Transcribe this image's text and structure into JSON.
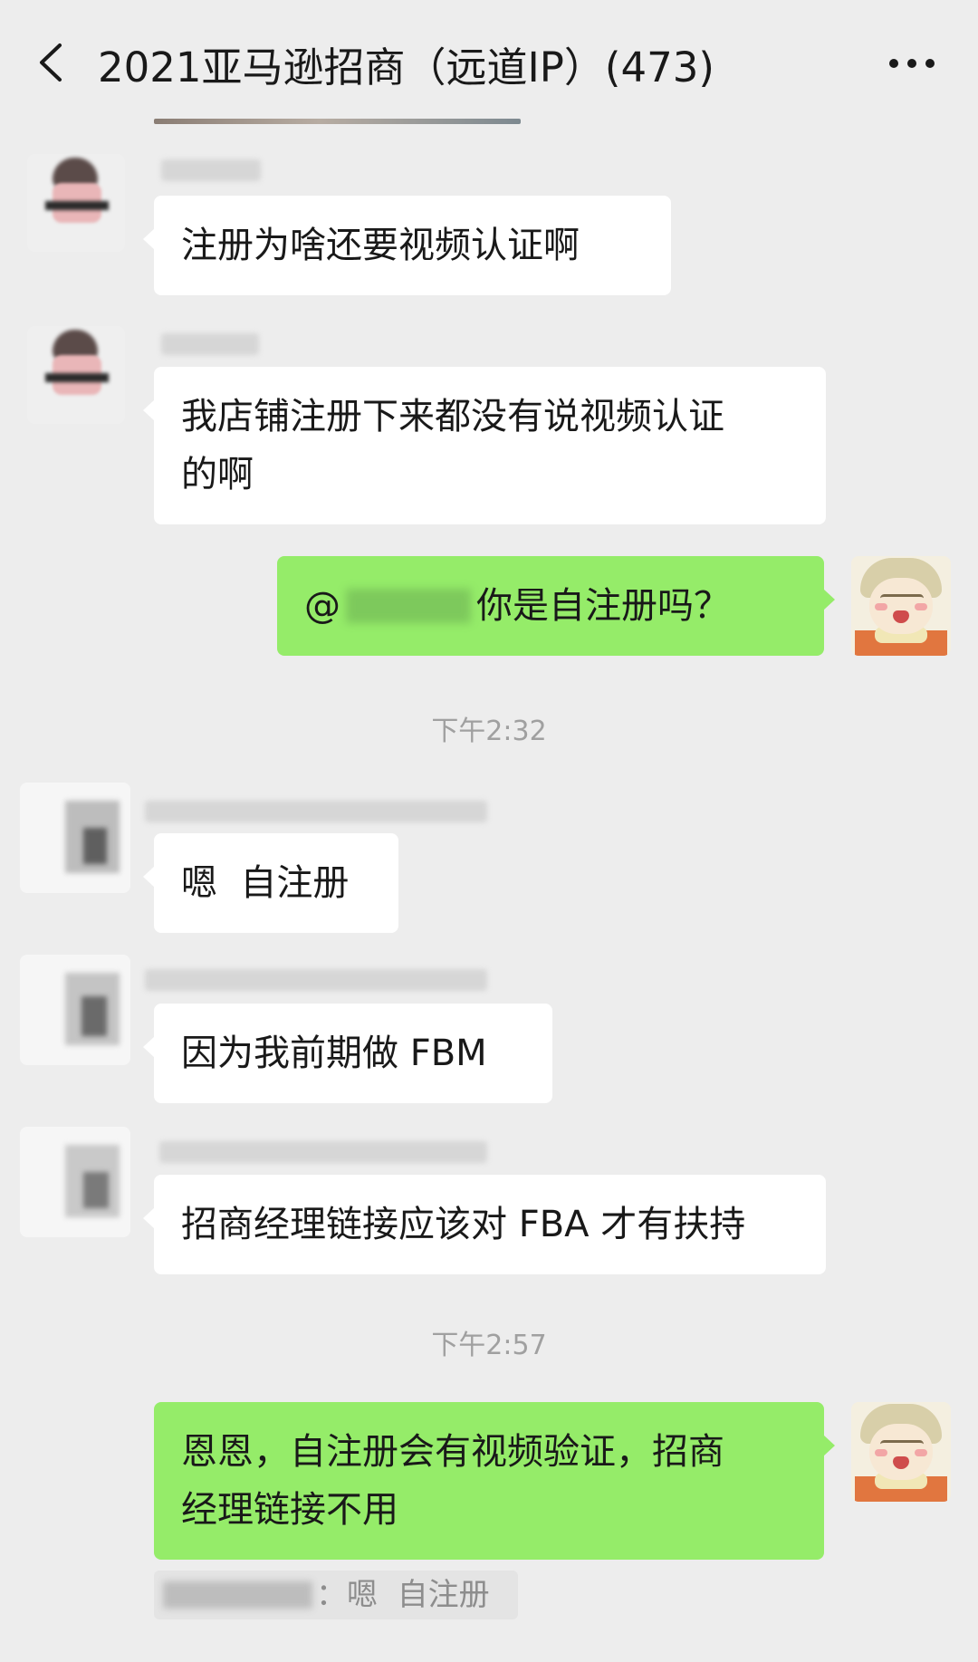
{
  "header": {
    "title": "2021亚马逊招商（远道IP）(473)",
    "back_icon": "chevron-left-icon",
    "more_icon": "ellipsis-icon"
  },
  "messages": [
    {
      "direction": "in",
      "text": "注册为啥还要视频认证啊"
    },
    {
      "direction": "in",
      "lines": [
        "我店铺注册下来都没有说视频认证",
        "的啊"
      ]
    },
    {
      "direction": "out",
      "prefix": "@",
      "suffix": "你是自注册吗？"
    },
    {
      "direction": "in",
      "text": "嗯  自注册"
    },
    {
      "direction": "in",
      "text": "因为我前期做 FBM"
    },
    {
      "direction": "in",
      "text": "招商经理链接应该对 FBA 才有扶持"
    },
    {
      "direction": "out",
      "lines": [
        "恩恩，自注册会有视频验证，招商",
        "经理链接不用"
      ]
    }
  ],
  "timestamps": [
    "下午2:32",
    "下午2:57"
  ],
  "quote": {
    "text": "：嗯  自注册"
  },
  "colors": {
    "background": "#ededed",
    "incoming_bubble": "#ffffff",
    "outgoing_bubble": "#95ec69",
    "timestamp": "#a0a0a0"
  }
}
